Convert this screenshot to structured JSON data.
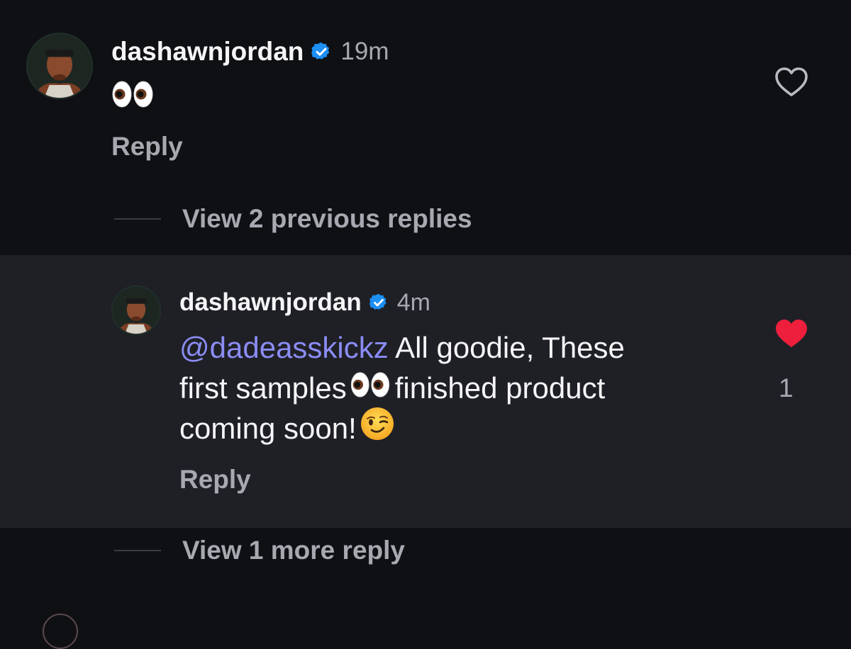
{
  "comments": [
    {
      "username": "dashawnjordan",
      "verified": true,
      "timestamp": "19m",
      "text": "👀",
      "reply_label": "Reply",
      "liked": false
    },
    {
      "username": "dashawnjordan",
      "verified": true,
      "timestamp": "4m",
      "mention": "@dadeasskickz",
      "text_line1": " All goodie, These",
      "text_line2_a": "first samples",
      "text_line2_b": "finished product",
      "text_line3": "coming soon!",
      "reply_label": "Reply",
      "liked": true,
      "like_count": "1"
    }
  ],
  "thread": {
    "view_previous_label": "View 2 previous replies",
    "view_more_label": "View 1 more reply"
  },
  "colors": {
    "background": "#0f1014",
    "highlight_background": "#1f2026",
    "mention": "#8b8cf5",
    "verified_badge": "#1d8ff5",
    "liked_heart": "#ee1f3c",
    "secondary_text": "#a6a9b0"
  },
  "icons": {
    "verified": "verified-badge-icon",
    "like_empty": "heart-outline-icon",
    "like_filled": "heart-filled-icon",
    "eyes_emoji": "eyes-emoji-icon",
    "wink_emoji": "winking-face-emoji-icon"
  }
}
